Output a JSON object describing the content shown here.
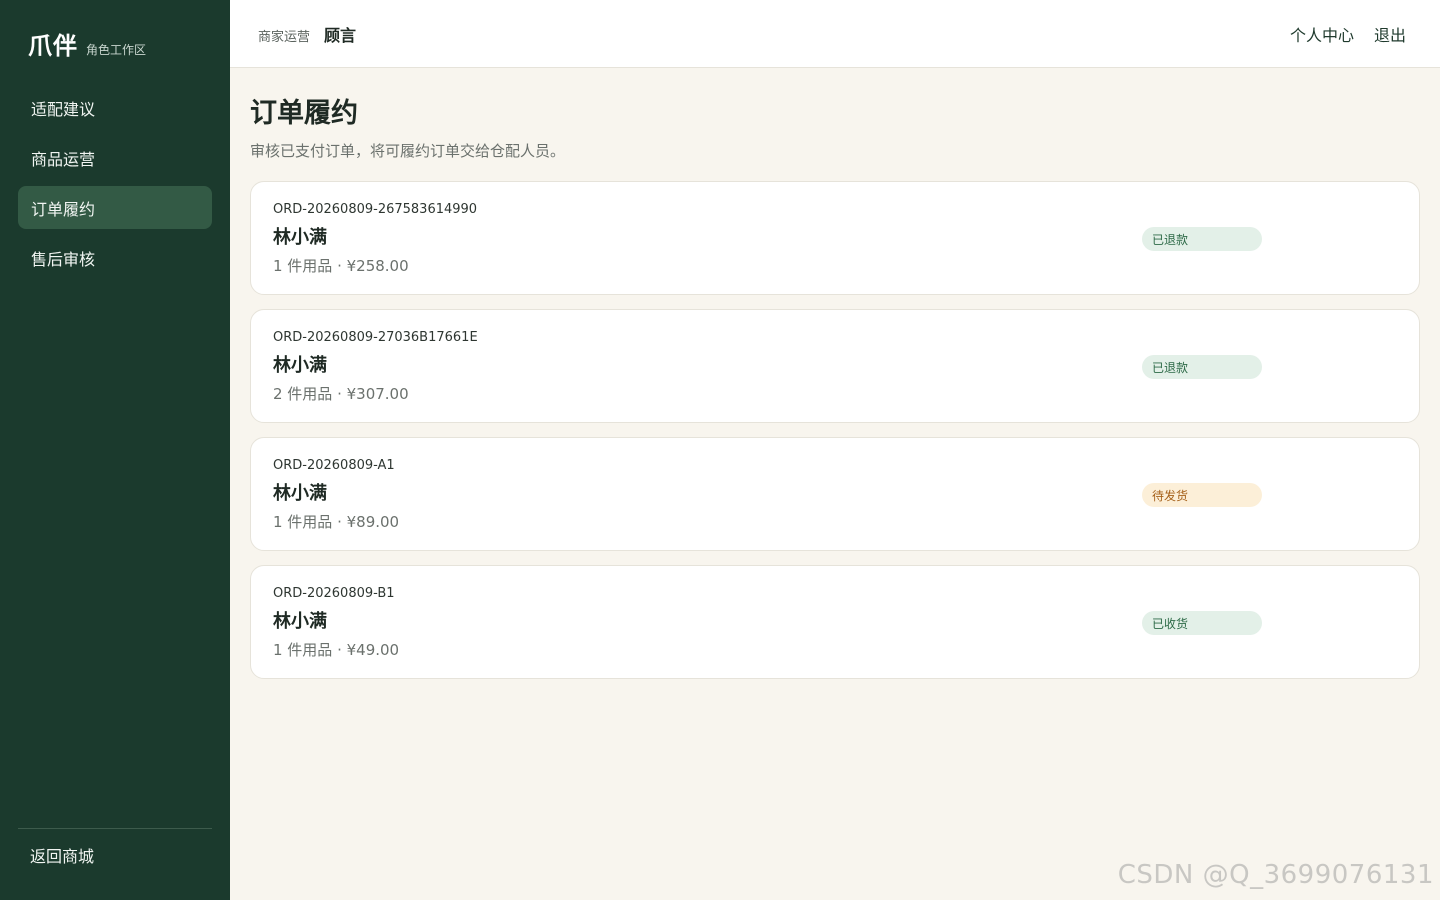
{
  "sidebar": {
    "brand_name": "爪伴",
    "brand_sub": "角色工作区",
    "items": [
      {
        "label": "适配建议"
      },
      {
        "label": "商品运营"
      },
      {
        "label": "订单履约"
      },
      {
        "label": "售后审核"
      }
    ],
    "footer_link": "返回商城"
  },
  "topbar": {
    "role": "商家运营",
    "user": "顾言",
    "profile_link": "个人中心",
    "logout_link": "退出"
  },
  "page": {
    "title": "订单履约",
    "description": "审核已支付订单，将可履约订单交给仓配人员。"
  },
  "orders": [
    {
      "id": "ORD-20260809-267583614990",
      "customer": "林小满",
      "summary": "1 件用品 · ¥258.00",
      "status": "已退款",
      "status_color": "#e3f0e8"
    },
    {
      "id": "ORD-20260809-27036B17661E",
      "customer": "林小满",
      "summary": "2 件用品 · ¥307.00",
      "status": "已退款",
      "status_color": "#e3f0e8"
    },
    {
      "id": "ORD-20260809-A1",
      "customer": "林小满",
      "summary": "1 件用品 · ¥89.00",
      "status": "待发货",
      "status_color": "#fcefd8"
    },
    {
      "id": "ORD-20260809-B1",
      "customer": "林小满",
      "summary": "1 件用品 · ¥49.00",
      "status": "已收货",
      "status_color": "#e3f0e8"
    }
  ],
  "watermark": "CSDN @Q_3699076131",
  "colors": {
    "sidebar_bg": "#1b3a2d",
    "active_nav": "#335a45",
    "page_bg": "#f8f5ee"
  }
}
